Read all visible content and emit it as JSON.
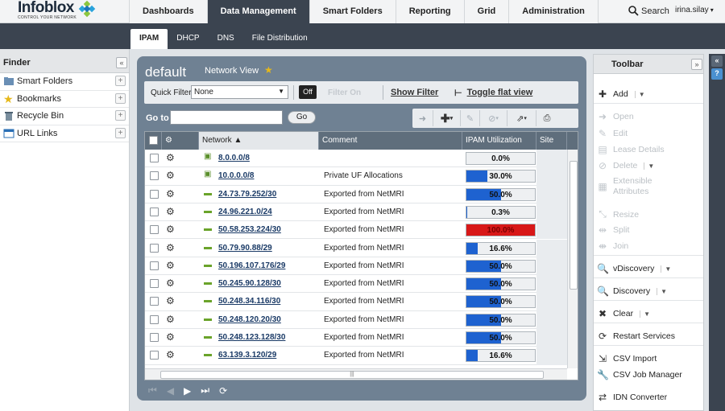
{
  "app": {
    "logo": "Infoblox",
    "tagline": "CONTROL YOUR NETWORK"
  },
  "nav": {
    "tabs": [
      "Dashboards",
      "Data Management",
      "Smart Folders",
      "Reporting",
      "Grid",
      "Administration"
    ],
    "search_label": "Search",
    "user": "irina.silay"
  },
  "subnav": {
    "tabs": [
      "IPAM",
      "DHCP",
      "DNS",
      "File Distribution"
    ]
  },
  "finder": {
    "title": "Finder",
    "items": [
      {
        "label": "Smart Folders",
        "icon": "folder-icon"
      },
      {
        "label": "Bookmarks",
        "icon": "star-icon"
      },
      {
        "label": "Recycle Bin",
        "icon": "recycle-bin-icon"
      },
      {
        "label": "URL Links",
        "icon": "link-icon"
      }
    ]
  },
  "main": {
    "title": "default",
    "network_view_label": "Network View",
    "quick_filter_label": "Quick Filter",
    "quick_filter_value": "None",
    "toggle_label": "Off",
    "filter_on_label": "Filter On",
    "show_filter": "Show Filter",
    "toggle_flat": "Toggle flat view",
    "goto_label": "Go to",
    "goto_button": "Go",
    "columns": {
      "network": "Network ▲",
      "comment": "Comment",
      "util": "IPAM Utilization",
      "site": "Site"
    },
    "rows": [
      {
        "network": "8.0.0.0/8",
        "type": "container",
        "comment": "",
        "util": "0.0%",
        "util_value": 0.0,
        "alert": false
      },
      {
        "network": "10.0.0.0/8",
        "type": "container",
        "comment": "Private UF Allocations",
        "util": "30.0%",
        "util_value": 30.0,
        "alert": false
      },
      {
        "network": "24.73.79.252/30",
        "type": "network",
        "comment": "Exported from NetMRI",
        "util": "50.0%",
        "util_value": 50.0,
        "alert": false
      },
      {
        "network": "24.96.221.0/24",
        "type": "network",
        "comment": "Exported from NetMRI",
        "util": "0.3%",
        "util_value": 0.3,
        "alert": false
      },
      {
        "network": "50.58.253.224/30",
        "type": "network",
        "comment": "Exported from NetMRI",
        "util": "100.0%",
        "util_value": 100.0,
        "alert": true
      },
      {
        "network": "50.79.90.88/29",
        "type": "network",
        "comment": "Exported from NetMRI",
        "util": "16.6%",
        "util_value": 16.6,
        "alert": false
      },
      {
        "network": "50.196.107.176/29",
        "type": "network",
        "comment": "Exported from NetMRI",
        "util": "50.0%",
        "util_value": 50.0,
        "alert": false
      },
      {
        "network": "50.245.90.128/30",
        "type": "network",
        "comment": "Exported from NetMRI",
        "util": "50.0%",
        "util_value": 50.0,
        "alert": false
      },
      {
        "network": "50.248.34.116/30",
        "type": "network",
        "comment": "Exported from NetMRI",
        "util": "50.0%",
        "util_value": 50.0,
        "alert": false
      },
      {
        "network": "50.248.120.20/30",
        "type": "network",
        "comment": "Exported from NetMRI",
        "util": "50.0%",
        "util_value": 50.0,
        "alert": false
      },
      {
        "network": "50.248.123.128/30",
        "type": "network",
        "comment": "Exported from NetMRI",
        "util": "50.0%",
        "util_value": 50.0,
        "alert": false
      },
      {
        "network": "63.139.3.120/29",
        "type": "network",
        "comment": "Exported from NetMRI",
        "util": "16.6%",
        "util_value": 16.6,
        "alert": false
      }
    ]
  },
  "toolbar": {
    "title": "Toolbar",
    "items": [
      {
        "label": "Add",
        "icon": "plus-icon",
        "enabled": true,
        "dropdown": true
      },
      {
        "label": "Open",
        "icon": "arrow-right-icon",
        "enabled": false,
        "dropdown": false
      },
      {
        "label": "Edit",
        "icon": "edit-icon",
        "enabled": false,
        "dropdown": false
      },
      {
        "label": "Lease Details",
        "icon": "lease-icon",
        "enabled": false,
        "dropdown": false
      },
      {
        "label": "Delete",
        "icon": "delete-icon",
        "enabled": false,
        "dropdown": true
      },
      {
        "label": "Extensible",
        "label2": "Attributes",
        "icon": "attributes-icon",
        "enabled": false,
        "dropdown": false
      },
      {
        "label": "Resize",
        "icon": "resize-icon",
        "enabled": false,
        "dropdown": false
      },
      {
        "label": "Split",
        "icon": "split-icon",
        "enabled": false,
        "dropdown": false
      },
      {
        "label": "Join",
        "icon": "join-icon",
        "enabled": false,
        "dropdown": false
      },
      {
        "label": "vDiscovery",
        "icon": "search-icon",
        "enabled": true,
        "dropdown": true
      },
      {
        "label": "Discovery",
        "icon": "search-icon",
        "enabled": true,
        "dropdown": true
      },
      {
        "label": "Clear",
        "icon": "clear-icon",
        "enabled": true,
        "dropdown": true
      },
      {
        "label": "Restart Services",
        "icon": "restart-icon",
        "enabled": true,
        "dropdown": false
      },
      {
        "label": "CSV Import",
        "icon": "csv-import-icon",
        "enabled": true,
        "dropdown": false
      },
      {
        "label": "CSV Job Manager",
        "icon": "wrench-icon",
        "enabled": true,
        "dropdown": false
      },
      {
        "label": "IDN Converter",
        "icon": "converter-icon",
        "enabled": true,
        "dropdown": false
      }
    ]
  }
}
